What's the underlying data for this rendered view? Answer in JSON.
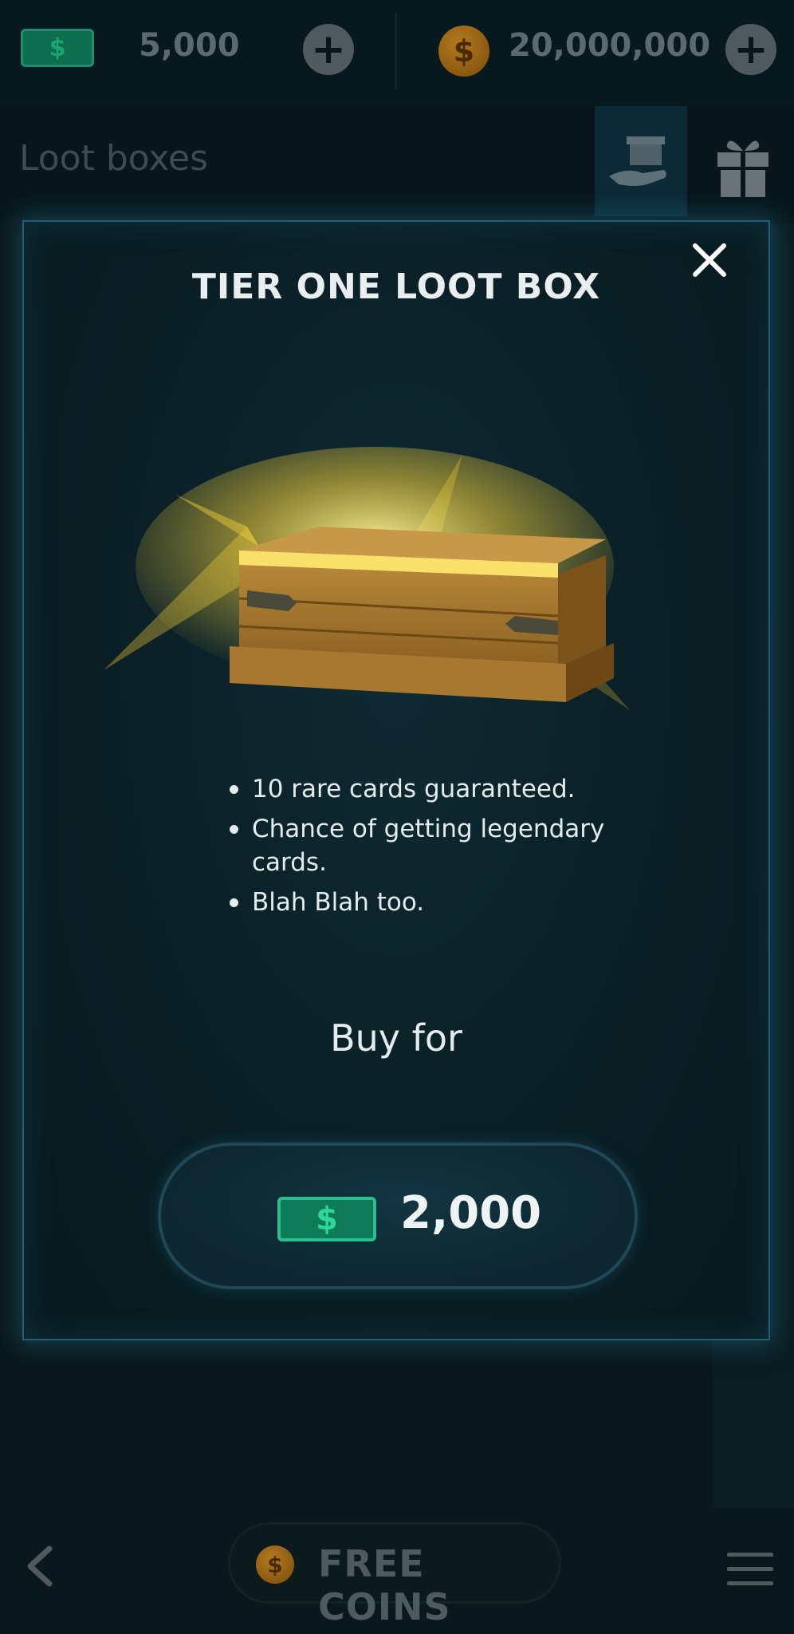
{
  "wallet": {
    "cash_amount": "5,000",
    "coins_amount": "20,000,000",
    "cash_symbol": "$",
    "coin_symbol": "$"
  },
  "header": {
    "title": "Loot boxes"
  },
  "bottom": {
    "free_coins_label": "FREE COINS"
  },
  "modal": {
    "title": "TIER ONE LOOT BOX",
    "features": [
      "10 rare cards guaranteed.",
      "Chance of getting legendary cards.",
      "Blah Blah too."
    ],
    "buy_label": "Buy for",
    "price": "2,000",
    "price_symbol": "$"
  },
  "colors": {
    "modal_border": "#1d5f74",
    "cash_green": "#2cbf8e",
    "coin_gold": "#b37a1e",
    "chest_glow": "#f5d23a"
  }
}
